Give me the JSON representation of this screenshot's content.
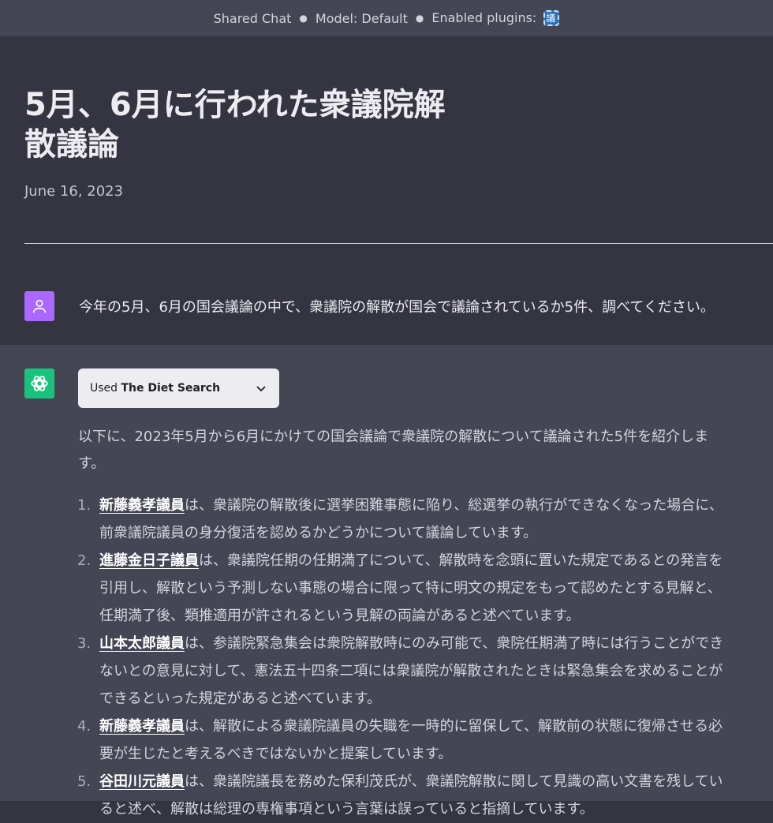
{
  "topbar": {
    "shared_chat": "Shared Chat",
    "model": "Model: Default",
    "plugins": "Enabled plugins:",
    "plugin_icon": "diet-search-plugin-icon"
  },
  "conversation": {
    "title": "5月、6月に行われた衆議院解散議論",
    "date": "June 16, 2023"
  },
  "user_message": {
    "avatar_icon": "user-icon",
    "text": "今年の5月、6月の国会議論の中で、衆議院の解散が国会で議論されているか5件、調べてください。"
  },
  "assistant_message": {
    "avatar_icon": "openai-logo-icon",
    "used_prefix": "Used",
    "used_plugin": "The Diet Search",
    "intro": "以下に、2023年5月から6月にかけての国会議論で衆議院の解散について議論された5件を紹介します。",
    "items": [
      {
        "num": "1.",
        "name": "新藤義孝議員",
        "text": "は、衆議院の解散後に選挙困難事態に陥り、総選挙の執行ができなくなった場合に、前衆議院議員の身分復活を認めるかどうかについて議論しています。"
      },
      {
        "num": "2.",
        "name": "進藤金日子議員",
        "text": "は、衆議院任期の任期満了について、解散時を念頭に置いた規定であるとの発言を引用し、解散という予測しない事態の場合に限って特に明文の規定をもって認めたとする見解と、任期満了後、類推適用が許されるという見解の両論があると述べています。"
      },
      {
        "num": "3.",
        "name": "山本太郎議員",
        "text": "は、参議院緊急集会は衆院解散時にのみ可能で、衆院任期満了時には行うことができないとの意見に対して、憲法五十四条二項には衆議院が解散されたときは緊急集会を求めることができるといった規定があると述べています。"
      },
      {
        "num": "4.",
        "name": "新藤義孝議員",
        "text": "は、解散による衆議院議員の失職を一時的に留保して、解散前の状態に復帰させる必要が生じたと考えるべきではないかと提案しています。"
      },
      {
        "num": "5.",
        "name": "谷田川元議員",
        "text": "は、衆議院議長を務めた保利茂氏が、衆議院解散に関して見識の高い文書を残していると述べ、解散は総理の専権事項という言葉は誤っていると指摘しています。"
      }
    ]
  }
}
